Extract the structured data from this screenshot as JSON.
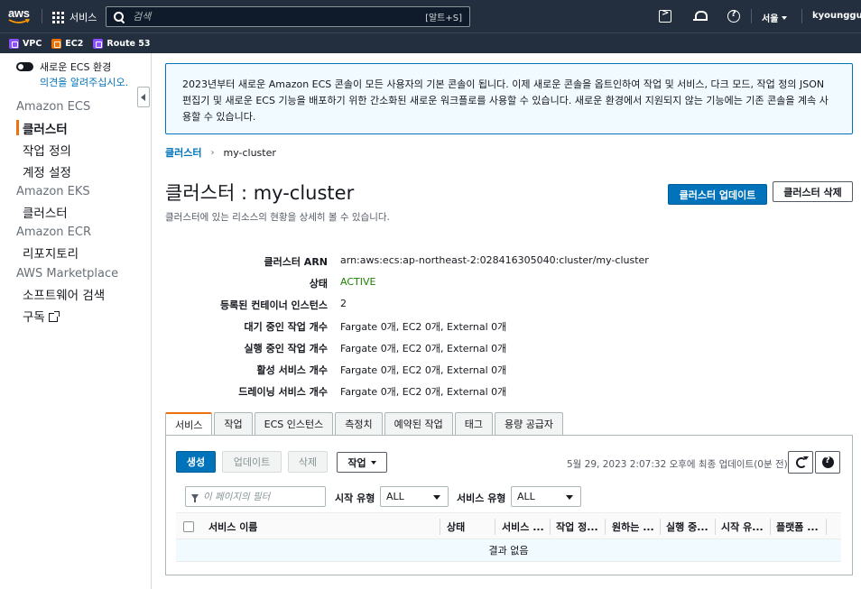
{
  "topnav": {
    "services_label": "서비스",
    "search_placeholder": "검색",
    "search_shortcut": "[알트+S]",
    "region": "서울",
    "user": "kyounggu"
  },
  "favorites": [
    {
      "label": "VPC",
      "icon": "vpc-icon",
      "color": "#8c4fff"
    },
    {
      "label": "EC2",
      "icon": "ec2-icon",
      "color": "#ed7100"
    },
    {
      "label": "Route 53",
      "icon": "route53-icon",
      "color": "#8c4fff"
    }
  ],
  "sidebar": {
    "toggle_label": "새로운 ECS 환경",
    "feedback_link": "의견을 알려주십시오.",
    "sections": [
      {
        "title": "Amazon ECS",
        "items": [
          "클러스터",
          "작업 정의",
          "계정 설정"
        ]
      },
      {
        "title": "Amazon EKS",
        "items": [
          "클러스터"
        ]
      },
      {
        "title": "Amazon ECR",
        "items": [
          "리포지토리"
        ]
      },
      {
        "title": "AWS Marketplace",
        "items": [
          "소프트웨어 검색",
          "구독"
        ]
      }
    ],
    "active_item": "클러스터"
  },
  "info_box": {
    "text": "2023년부터 새로운 Amazon ECS 콘솔이 모든 사용자의 기본 콘솔이 됩니다. 이제 새로운 콘솔을 옵트인하여 작업 및 서비스, 다크 모드, 작업 정의 JSON 편집기 및 새로운 ECS 기능을 배포하기 위한 간소화된 새로운 워크플로를 사용할 수 있습니다. 새로운 환경에서 지원되지 않는 기능에는 기존 콘솔을 계속 사용할 수 있습니다."
  },
  "breadcrumb": {
    "parent": "클러스터",
    "current": "my-cluster"
  },
  "page": {
    "title": "클러스터 : my-cluster",
    "description": "클러스터에 있는 리소스의 현황을 상세히 볼 수 있습니다.",
    "update_button": "클러스터 업데이트",
    "delete_button": "클러스터 삭제"
  },
  "details": [
    {
      "label": "클러스터 ARN",
      "value": "arn:aws:ecs:ap-northeast-2:028416305040:cluster/my-cluster"
    },
    {
      "label": "상태",
      "value": "ACTIVE"
    },
    {
      "label": "등록된 컨테이너 인스턴스",
      "value": "2"
    },
    {
      "label": "대기 중인 작업 개수",
      "value": "Fargate 0개, EC2 0개, External 0개"
    },
    {
      "label": "실행 중인 작업 개수",
      "value": "Fargate 0개, EC2 0개, External 0개"
    },
    {
      "label": "활성 서비스 개수",
      "value": "Fargate 0개, EC2 0개, External 0개"
    },
    {
      "label": "드레이닝 서비스 개수",
      "value": "Fargate 0개, EC2 0개, External 0개"
    }
  ],
  "tabs": [
    "서비스",
    "작업",
    "ECS 인스턴스",
    "측정치",
    "예약된 작업",
    "태그",
    "용량 공급자"
  ],
  "services_panel": {
    "create_button": "생성",
    "update_button": "업데이트",
    "delete_button": "삭제",
    "actions_button": "작업",
    "last_updated": "5월 29, 2023 2:07:32 오후에 최종 업데이트(0분 전)",
    "filter_placeholder": "이 페이지의 필터",
    "launch_type_label": "시작 유형",
    "launch_type_value": "ALL",
    "service_type_label": "서비스 유형",
    "service_type_value": "ALL",
    "columns": [
      "서비스 이름",
      "상태",
      "서비스 ...",
      "작업 정...",
      "원하는 ...",
      "실행 중...",
      "시작 유...",
      "플랫폼 ..."
    ],
    "empty_text": "결과 없음"
  },
  "colors": {
    "nav_bg": "#232f3e",
    "primary": "#0073bb",
    "accent": "#ec7211",
    "status_active": "#1d8102"
  }
}
